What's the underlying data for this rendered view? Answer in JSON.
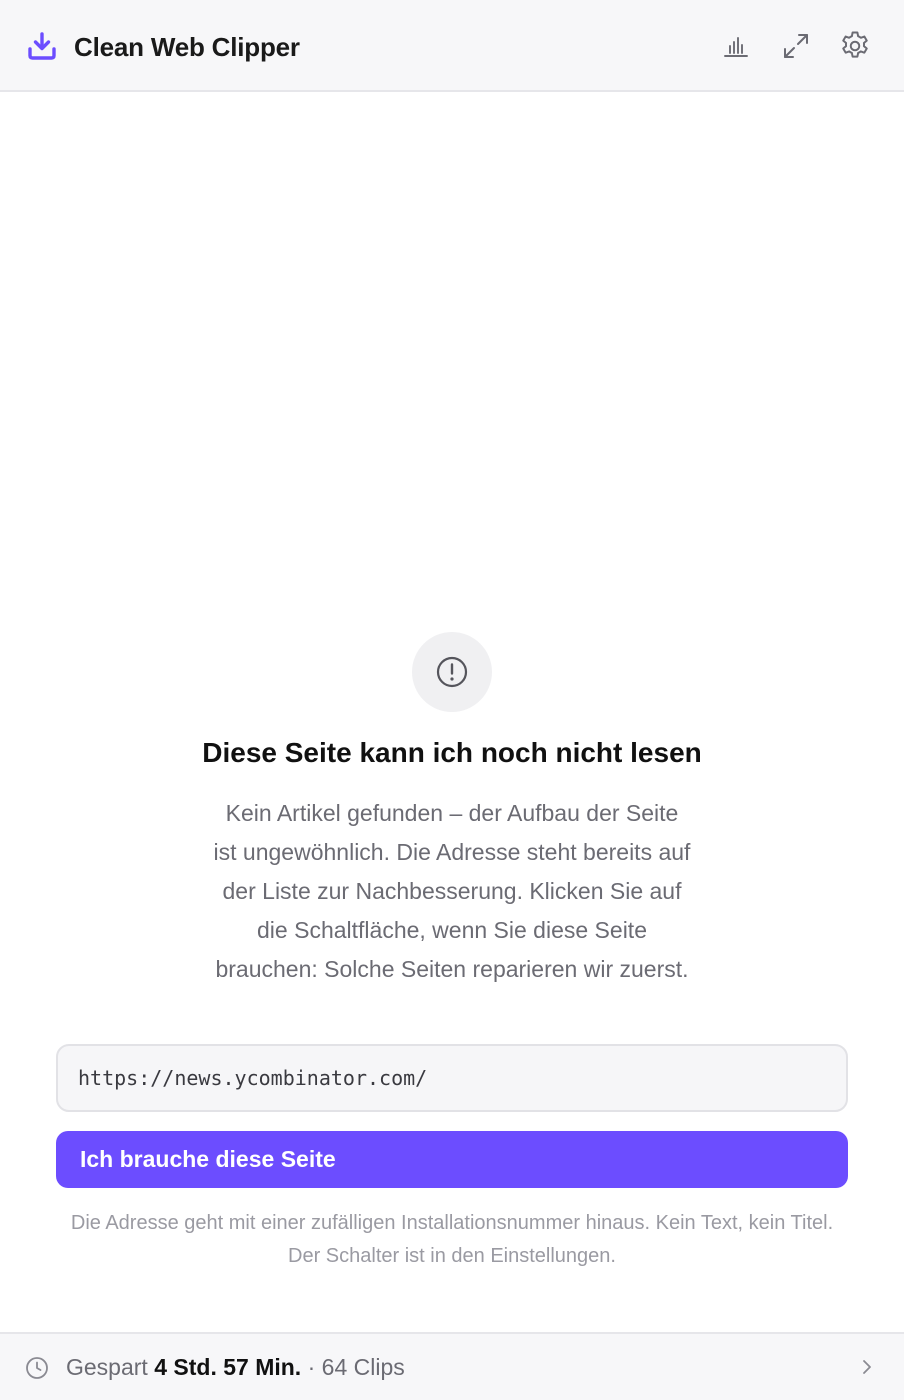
{
  "header": {
    "title": "Clean Web Clipper",
    "brand_icon": "download-tray-icon",
    "accent_color": "#6c4dff",
    "actions": [
      {
        "icon": "bar-chart-icon",
        "name": "stats-button"
      },
      {
        "icon": "expand-icon",
        "name": "expand-button"
      },
      {
        "icon": "gear-icon",
        "name": "settings-button"
      }
    ]
  },
  "empty_state": {
    "icon": "alert-circle-icon",
    "title": "Diese Seite kann ich noch nicht lesen",
    "description": "Kein Artikel gefunden – der Aufbau der Seite ist ungewöhnlich. Die Adresse steht bereits auf der Liste zur Nachbesserung. Klicken Sie auf die Schaltfläche, wenn Sie diese Seite brauchen: Solche Seiten reparieren wir zuerst.",
    "url": "https://news.ycombinator.com/",
    "button_label": "Ich brauche diese Seite",
    "privacy_note": "Die Adresse geht mit einer zufälligen Installationsnummer hinaus. Kein Text, kein Titel. Der Schalter ist in den Einstellungen."
  },
  "footer": {
    "icon": "clock-icon",
    "saved_label": "Gespart",
    "saved_value": "4 Std. 57 Min.",
    "separator": "·",
    "clips": "64 Clips",
    "chevron_icon": "chevron-right-icon"
  }
}
